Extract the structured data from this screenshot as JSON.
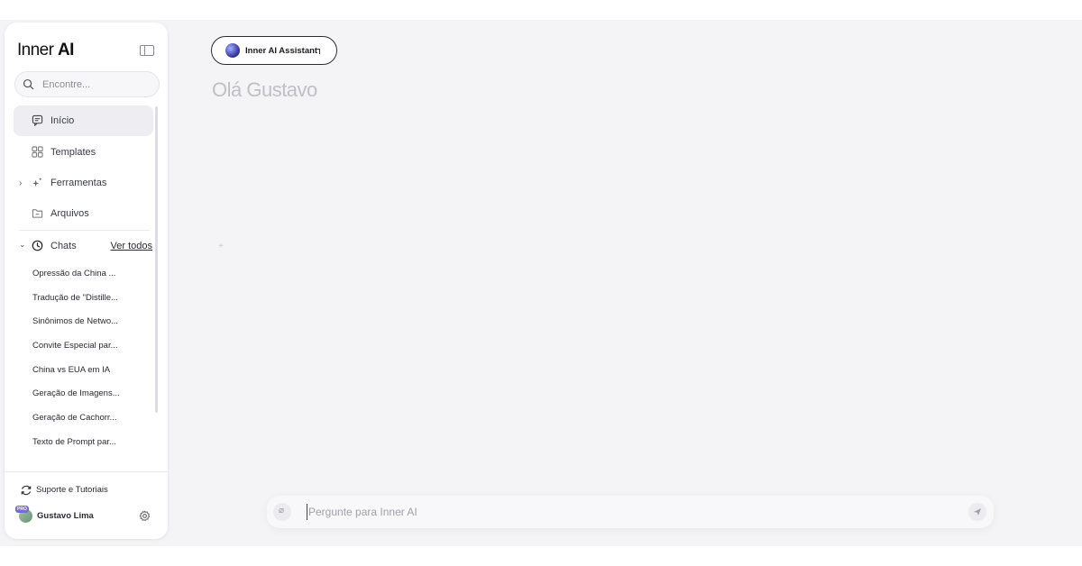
{
  "sidebar": {
    "logo_regular": "Inner",
    "logo_bold": "AI",
    "search_placeholder": "Encontre...",
    "nav": {
      "inicio": "Início",
      "templates": "Templates",
      "ferramentas": "Ferramentas",
      "arquivos": "Arquivos"
    },
    "chats": {
      "label": "Chats",
      "see_all": "Ver todos",
      "items": [
        "Opressão da China ...",
        "Tradução de \"Distille...",
        "Sinônimos de Netwo...",
        "Convite Especial par...",
        "China vs EUA em IA",
        "Geração de Imagens...",
        "Geração de Cachorr...",
        "Texto de Prompt par..."
      ]
    },
    "support_label": "Suporte e Tutoriais",
    "user": {
      "name": "Gustavo Lima",
      "badge": "PRO"
    }
  },
  "main": {
    "assistant_label": "Inner AI Assistant",
    "greeting": "Olá Gustavo",
    "plus_hint": "+",
    "composer_placeholder": "Pergunte para Inner AI"
  },
  "colors": {
    "background": "#f4f4f6",
    "sidebar": "#ffffff",
    "active_nav": "#eeeef2",
    "pro_badge": "#7a6bd6"
  },
  "icons": {
    "search": "search-icon",
    "collapse": "sidebar-toggle-icon",
    "inicio": "chat-bubble-icon",
    "templates": "grid-icon",
    "ferramentas": "sparkle-icon",
    "arquivos": "folder-icon",
    "chats": "clock-icon",
    "support": "refresh-icon",
    "settings": "gear-icon",
    "attach": "paperclip-icon",
    "send": "send-icon"
  }
}
